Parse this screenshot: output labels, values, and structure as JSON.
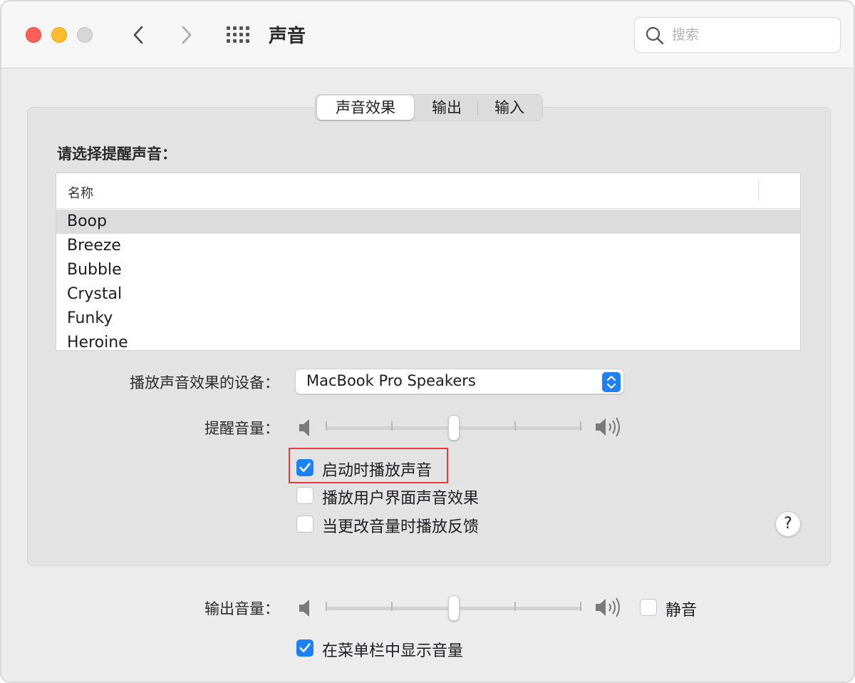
{
  "window": {
    "title": "声音",
    "search": {
      "placeholder": "搜索",
      "value": ""
    }
  },
  "tabs": [
    {
      "label": "声音效果",
      "active": true
    },
    {
      "label": "输出",
      "active": false
    },
    {
      "label": "输入",
      "active": false
    }
  ],
  "alert_section": {
    "label": "请选择提醒声音：",
    "list": {
      "column_header": "名称",
      "items": [
        "Boop",
        "Breeze",
        "Bubble",
        "Crystal",
        "Funky",
        "Heroine"
      ],
      "selected": "Boop"
    }
  },
  "device": {
    "label": "播放声音效果的设备：",
    "value": "MacBook Pro Speakers"
  },
  "alert_volume": {
    "label": "提醒音量：",
    "level_fraction": 0.5
  },
  "options": [
    {
      "label": "启动时播放声音",
      "checked": true,
      "highlighted": true
    },
    {
      "label": "播放用户界面声音效果",
      "checked": false,
      "highlighted": false
    },
    {
      "label": "当更改音量时播放反馈",
      "checked": false,
      "highlighted": false
    }
  ],
  "help_label": "?",
  "output_volume": {
    "label": "输出音量：",
    "level_fraction": 0.5,
    "mute": {
      "label": "静音",
      "checked": false
    }
  },
  "menubar_option": {
    "label": "在菜单栏中显示音量",
    "checked": true
  },
  "colors": {
    "accent": "#1a82f8",
    "highlight_border": "#e23d3d",
    "selected_row": "#dcdcdc"
  }
}
